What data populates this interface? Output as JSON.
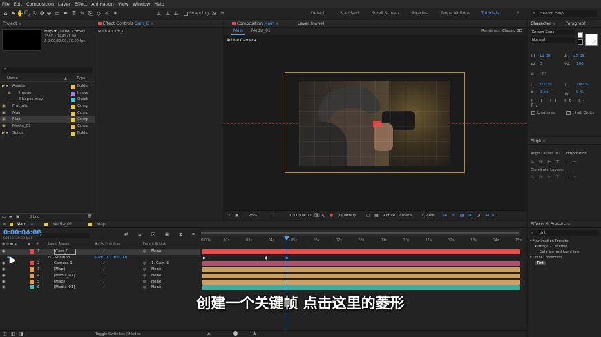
{
  "menu": [
    "File",
    "Edit",
    "Composition",
    "Layer",
    "Effect",
    "Animation",
    "View",
    "Window",
    "Help"
  ],
  "toolbar": {
    "snapping": "Snapping",
    "workspaces": [
      "Default",
      "Standard",
      "Small Screen",
      "Libraries",
      "Dope Motions",
      "Tutorials"
    ],
    "active_workspace": "Tutorials",
    "search_placeholder": "Search Help"
  },
  "project": {
    "title": "Project",
    "selected": {
      "name": "Map",
      "used": "▼ , used 2 times",
      "dims": "2560 x 1440 (1.00)",
      "duration": "Δ 0;00;30;00, 30.00 fps"
    },
    "col_name": "Name",
    "col_type": "Type",
    "bpc": "8 bpc",
    "items": [
      {
        "name": "Assets",
        "type": "Folder",
        "color": "#e8c84a",
        "kind": "folder",
        "indent": 0
      },
      {
        "name": "Image",
        "type": "Impor",
        "color": "#a779e0",
        "kind": "image",
        "indent": 1
      },
      {
        "name": "Shapes.mov",
        "type": "Quick",
        "color": "#3fc3d8",
        "kind": "movie",
        "indent": 1
      },
      {
        "name": "Fractals",
        "type": "Comp",
        "color": "#e8c84a",
        "kind": "comp",
        "indent": 0
      },
      {
        "name": "Main",
        "type": "Comp",
        "color": "#e8c84a",
        "kind": "comp",
        "indent": 0
      },
      {
        "name": "Map",
        "type": "Comp",
        "color": "#e8c84a",
        "kind": "comp",
        "indent": 0,
        "selected": true
      },
      {
        "name": "Media_01",
        "type": "Comp",
        "color": "#e8c84a",
        "kind": "comp",
        "indent": 0
      },
      {
        "name": "Solids",
        "type": "Folder",
        "color": "#e8c84a",
        "kind": "folder",
        "indent": 0
      }
    ]
  },
  "effect_controls": {
    "title": "Effect Controls",
    "layer": "Cam_C",
    "sub": "Main • Cam_C"
  },
  "composition": {
    "title": "Composition",
    "name": "Main",
    "tabs": [
      "Main",
      "Media_01"
    ],
    "layer_tab": "Layer (none)",
    "renderer_label": "Renderer:",
    "renderer": "Classic 3D",
    "view_label": "Active Camera"
  },
  "viewer_bar": {
    "zoom": "25%",
    "timecode": "0:00:04:00",
    "resolution": "(Quarter)",
    "camera": "Active Camera",
    "views": "1 View",
    "exposure": "+0.0"
  },
  "character": {
    "tabs": [
      "Character",
      "Paragraph"
    ],
    "font": "Kelson Sans",
    "style": "Normal",
    "size": "12 px",
    "leading": "25 px",
    "tracking": "0",
    "kerning": "100",
    "indent": "- px",
    "vscale": "100 %",
    "hscale": "100 %",
    "baseline": "0 px",
    "tsume": "0 %",
    "ligatures": "Ligatures",
    "hindi": "Hindi Digits"
  },
  "align": {
    "title": "Align",
    "align_to_label": "Align Layers to:",
    "align_to": "Composition",
    "distribute": "Distribute Layers:"
  },
  "effects_presets": {
    "title": "Effects & Presets",
    "search": "tint",
    "tree": [
      {
        "label": "* Animation Presets",
        "indent": 0
      },
      {
        "label": "Image - Creative",
        "indent": 1
      },
      {
        "label": "Colorize_red hand tint",
        "indent": 2
      },
      {
        "label": "Color Correction",
        "indent": 0
      },
      {
        "label": "Tint",
        "indent": 1,
        "selected": true
      }
    ]
  },
  "timeline": {
    "tabs": [
      "Main",
      "Media_01",
      "Map"
    ],
    "timecode": "0:00:04:00",
    "fps": "00120 (30.00 fps)",
    "col_layer_name": "Layer Name",
    "col_parent": "Parent & Link",
    "toggle": "Toggle Switches / Modes",
    "ruler": [
      "0:00s",
      "02s",
      "03s",
      "04s",
      "05s",
      "06s",
      "07s",
      "08s",
      "09s",
      "10s",
      "11s",
      "12s",
      "13s",
      "14s",
      "15s"
    ],
    "layers": [
      {
        "num": "1",
        "name": "Cam_C",
        "color": "#e84b4b",
        "parent": "None",
        "bar": "#e84b4b",
        "selected": true
      },
      {
        "num": "",
        "name": "Position",
        "color": "",
        "parent": "",
        "bar": "",
        "prop": "1280.0,720.0,0.0"
      },
      {
        "num": "2",
        "name": "Camera 1",
        "color": "#e84b4b",
        "parent": "1. Cam_C",
        "bar": "#b0506a"
      },
      {
        "num": "3",
        "name": "[Map]",
        "color": "#e8a040",
        "parent": "None",
        "bar": "#c9a060"
      },
      {
        "num": "4",
        "name": "[Media_01]",
        "color": "#e8a040",
        "parent": "None",
        "bar": "#c9a060"
      },
      {
        "num": "5",
        "name": "[Map]",
        "color": "#e8a040",
        "parent": "None",
        "bar": "#c9a060"
      },
      {
        "num": "6",
        "name": "[Media_01]",
        "color": "#3fc3b0",
        "parent": "None",
        "bar": "#3fb0a0"
      }
    ]
  },
  "subtitle": "创建一个关键帧 点击这里的菱形"
}
